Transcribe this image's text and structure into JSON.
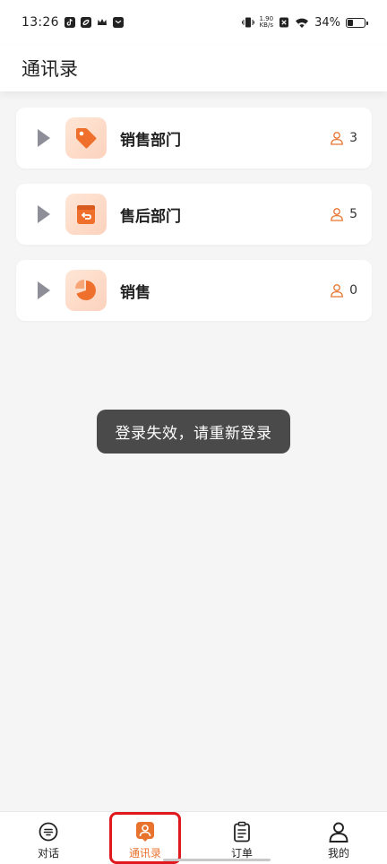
{
  "status_bar": {
    "time": "13:26",
    "net_speed_value": "1.90",
    "net_speed_unit": "KB/s",
    "battery": "34%",
    "battery_level": 0.34
  },
  "header": {
    "title": "通讯录"
  },
  "departments": [
    {
      "name": "销售部门",
      "count": "3",
      "icon": "price-tag-icon"
    },
    {
      "name": "售后部门",
      "count": "5",
      "icon": "return-box-icon"
    },
    {
      "name": "销售",
      "count": "0",
      "icon": "pie-chart-icon"
    }
  ],
  "toast": {
    "text": "登录失效，请重新登录"
  },
  "bottom_nav": [
    {
      "label": "对话",
      "icon": "chat-icon",
      "active": false
    },
    {
      "label": "通讯录",
      "icon": "contacts-icon",
      "active": true
    },
    {
      "label": "订单",
      "icon": "clipboard-icon",
      "active": false
    },
    {
      "label": "我的",
      "icon": "person-icon",
      "active": false
    }
  ],
  "colors": {
    "accent": "#e8732e",
    "icon_bg": "#fcd9c5",
    "toast_bg": "#4a4a4a",
    "highlight": "#e0191e"
  }
}
